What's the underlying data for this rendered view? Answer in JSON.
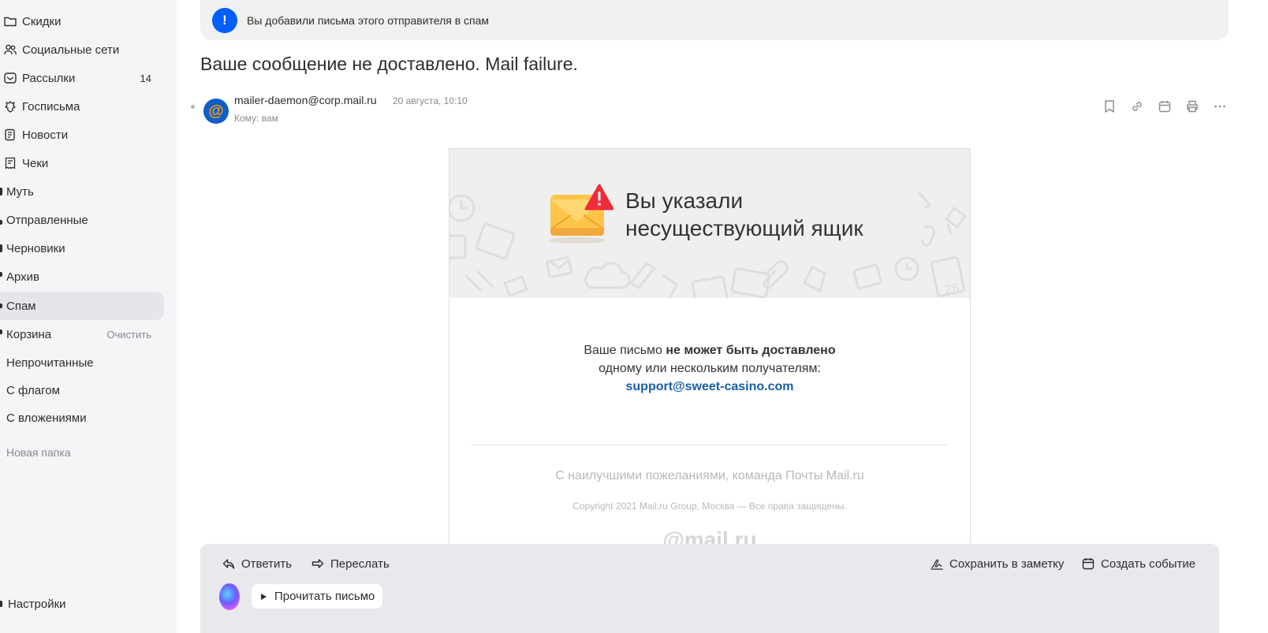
{
  "sidebar": {
    "folders": [
      {
        "label": "Скидки",
        "icon": "folder-icon"
      },
      {
        "label": "Социальные сети",
        "icon": "people-icon"
      },
      {
        "label": "Рассылки",
        "icon": "newsletter-icon",
        "count": "14"
      },
      {
        "label": "Госписьма",
        "icon": "gov-emblem-icon"
      },
      {
        "label": "Новости",
        "icon": "news-icon"
      },
      {
        "label": "Чеки",
        "icon": "receipt-icon"
      },
      {
        "label": "Муть",
        "icon": "folder-icon"
      },
      {
        "label": "Отправленные",
        "icon": "sent-icon"
      },
      {
        "label": "Черновики",
        "icon": "draft-icon"
      },
      {
        "label": "Архив",
        "icon": "archive-icon"
      },
      {
        "label": "Спам",
        "icon": "spam-icon",
        "active": true
      },
      {
        "label": "Корзина",
        "icon": "trash-icon",
        "action": "Очистить"
      },
      {
        "label": "Непрочитанные"
      },
      {
        "label": "С флагом"
      },
      {
        "label": "С вложениями"
      }
    ],
    "new_folder": "Новая папка",
    "settings": "Настройки"
  },
  "notice": {
    "text": "Вы добавили письма этого отправителя в спам",
    "icon": "exclamation-icon",
    "color": "#005ff9"
  },
  "message": {
    "subject": "Ваше сообщение не доставлено. Mail failure.",
    "sender": "mailer-daemon@corp.mail.ru",
    "date": "20 августа, 10:10",
    "to": "Кому: вам",
    "avatar_glyph": "@",
    "tools": [
      "bookmark-icon",
      "link-icon",
      "calendar-icon",
      "print-icon",
      "more-icon"
    ]
  },
  "letter": {
    "banner_title_line1": "Вы указали",
    "banner_title_line2": "несуществующий ящик",
    "body_prefix": "Ваше письмо ",
    "body_bold": "не может быть доставлено",
    "body_line2": "одному или нескольким получателям:",
    "recipient": "support@sweet-casino.com",
    "regards": "С наилучшими пожеланиями, команда Почты Mail.ru",
    "copyright": "Copyright 2021 Mail.ru Group, Москва — Все права защищены.",
    "logo": "@mail.ru"
  },
  "actions": {
    "reply": "Ответить",
    "forward": "Переслать",
    "save_note": "Сохранить в заметку",
    "create_event": "Создать событие",
    "read_aloud": "Прочитать письмо"
  }
}
